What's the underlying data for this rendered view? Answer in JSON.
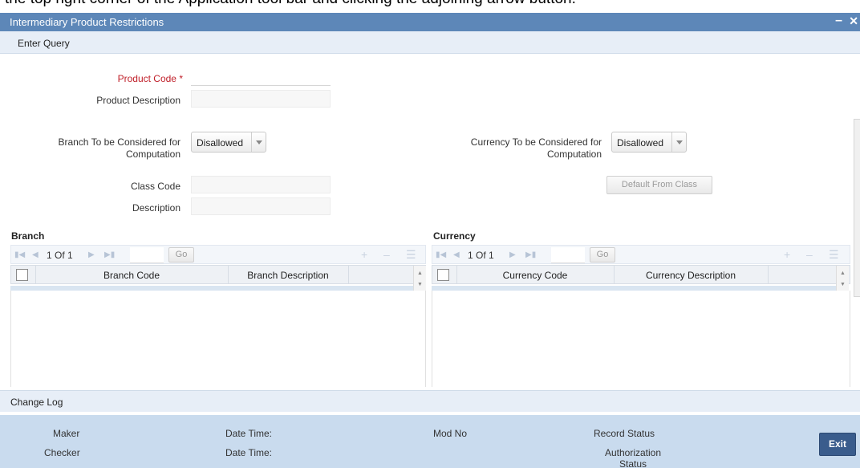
{
  "caption": "the top right corner of the Application tool bar and clicking the adjoining arrow button.",
  "window": {
    "title": "Intermediary Product Restrictions",
    "minimize_glyph": "–",
    "close_glyph": "✕"
  },
  "toolbar": {
    "enter_query": "Enter Query"
  },
  "form": {
    "product_code_label": "Product Code",
    "required_mark": "*",
    "product_code_value": "",
    "product_description_label": "Product Description",
    "product_description_value": "",
    "branch_consider_label_line1": "Branch To be Considered for",
    "branch_consider_label_line2": "Computation",
    "branch_consider_value": "Disallowed",
    "currency_consider_label_line1": "Currency To be Considered for",
    "currency_consider_label_line2": "Computation",
    "currency_consider_value": "Disallowed",
    "class_code_label": "Class Code",
    "class_code_value": "",
    "description_label": "Description",
    "description_value": "",
    "default_from_class_label": "Default From Class"
  },
  "branch": {
    "section_title": "Branch",
    "page_info": "1 Of 1",
    "go_label": "Go",
    "columns": [
      "Branch Code",
      "Branch Description"
    ]
  },
  "currency": {
    "section_title": "Currency",
    "page_info": "1 Of 1",
    "go_label": "Go",
    "columns": [
      "Currency Code",
      "Currency Description"
    ]
  },
  "change_log": {
    "title": "Change Log",
    "maker_label": "Maker",
    "checker_label": "Checker",
    "date_time_label": "Date Time:",
    "mod_no_label": "Mod No",
    "record_status_label": "Record Status",
    "authorization_status_label_line1": "Authorization",
    "authorization_status_label_line2": "Status",
    "exit_label": "Exit"
  }
}
